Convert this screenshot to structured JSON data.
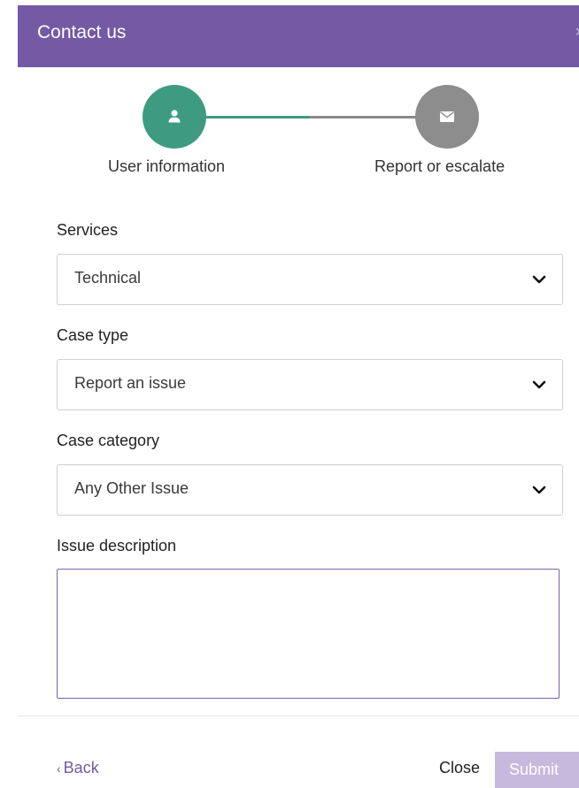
{
  "header": {
    "title": "Contact us",
    "close_label": "×"
  },
  "stepper": {
    "steps": [
      {
        "label": "User information",
        "icon": "user-icon",
        "state": "active"
      },
      {
        "label": "Report or escalate",
        "icon": "mail-icon",
        "state": "inactive"
      }
    ]
  },
  "form": {
    "services": {
      "label": "Services",
      "value": "Technical"
    },
    "case_type": {
      "label": "Case type",
      "value": "Report an issue"
    },
    "case_category": {
      "label": "Case category",
      "value": "Any Other Issue"
    },
    "issue_description": {
      "label": "Issue description",
      "value": ""
    }
  },
  "footer": {
    "back_label": "Back",
    "close_label": "Close",
    "submit_label": "Submit"
  },
  "colors": {
    "header": "#7459a4",
    "step_active": "#3e9b7f",
    "step_inactive": "#8d8d8d",
    "submit_disabled": "#c6b9dd",
    "link": "#7459a4"
  }
}
